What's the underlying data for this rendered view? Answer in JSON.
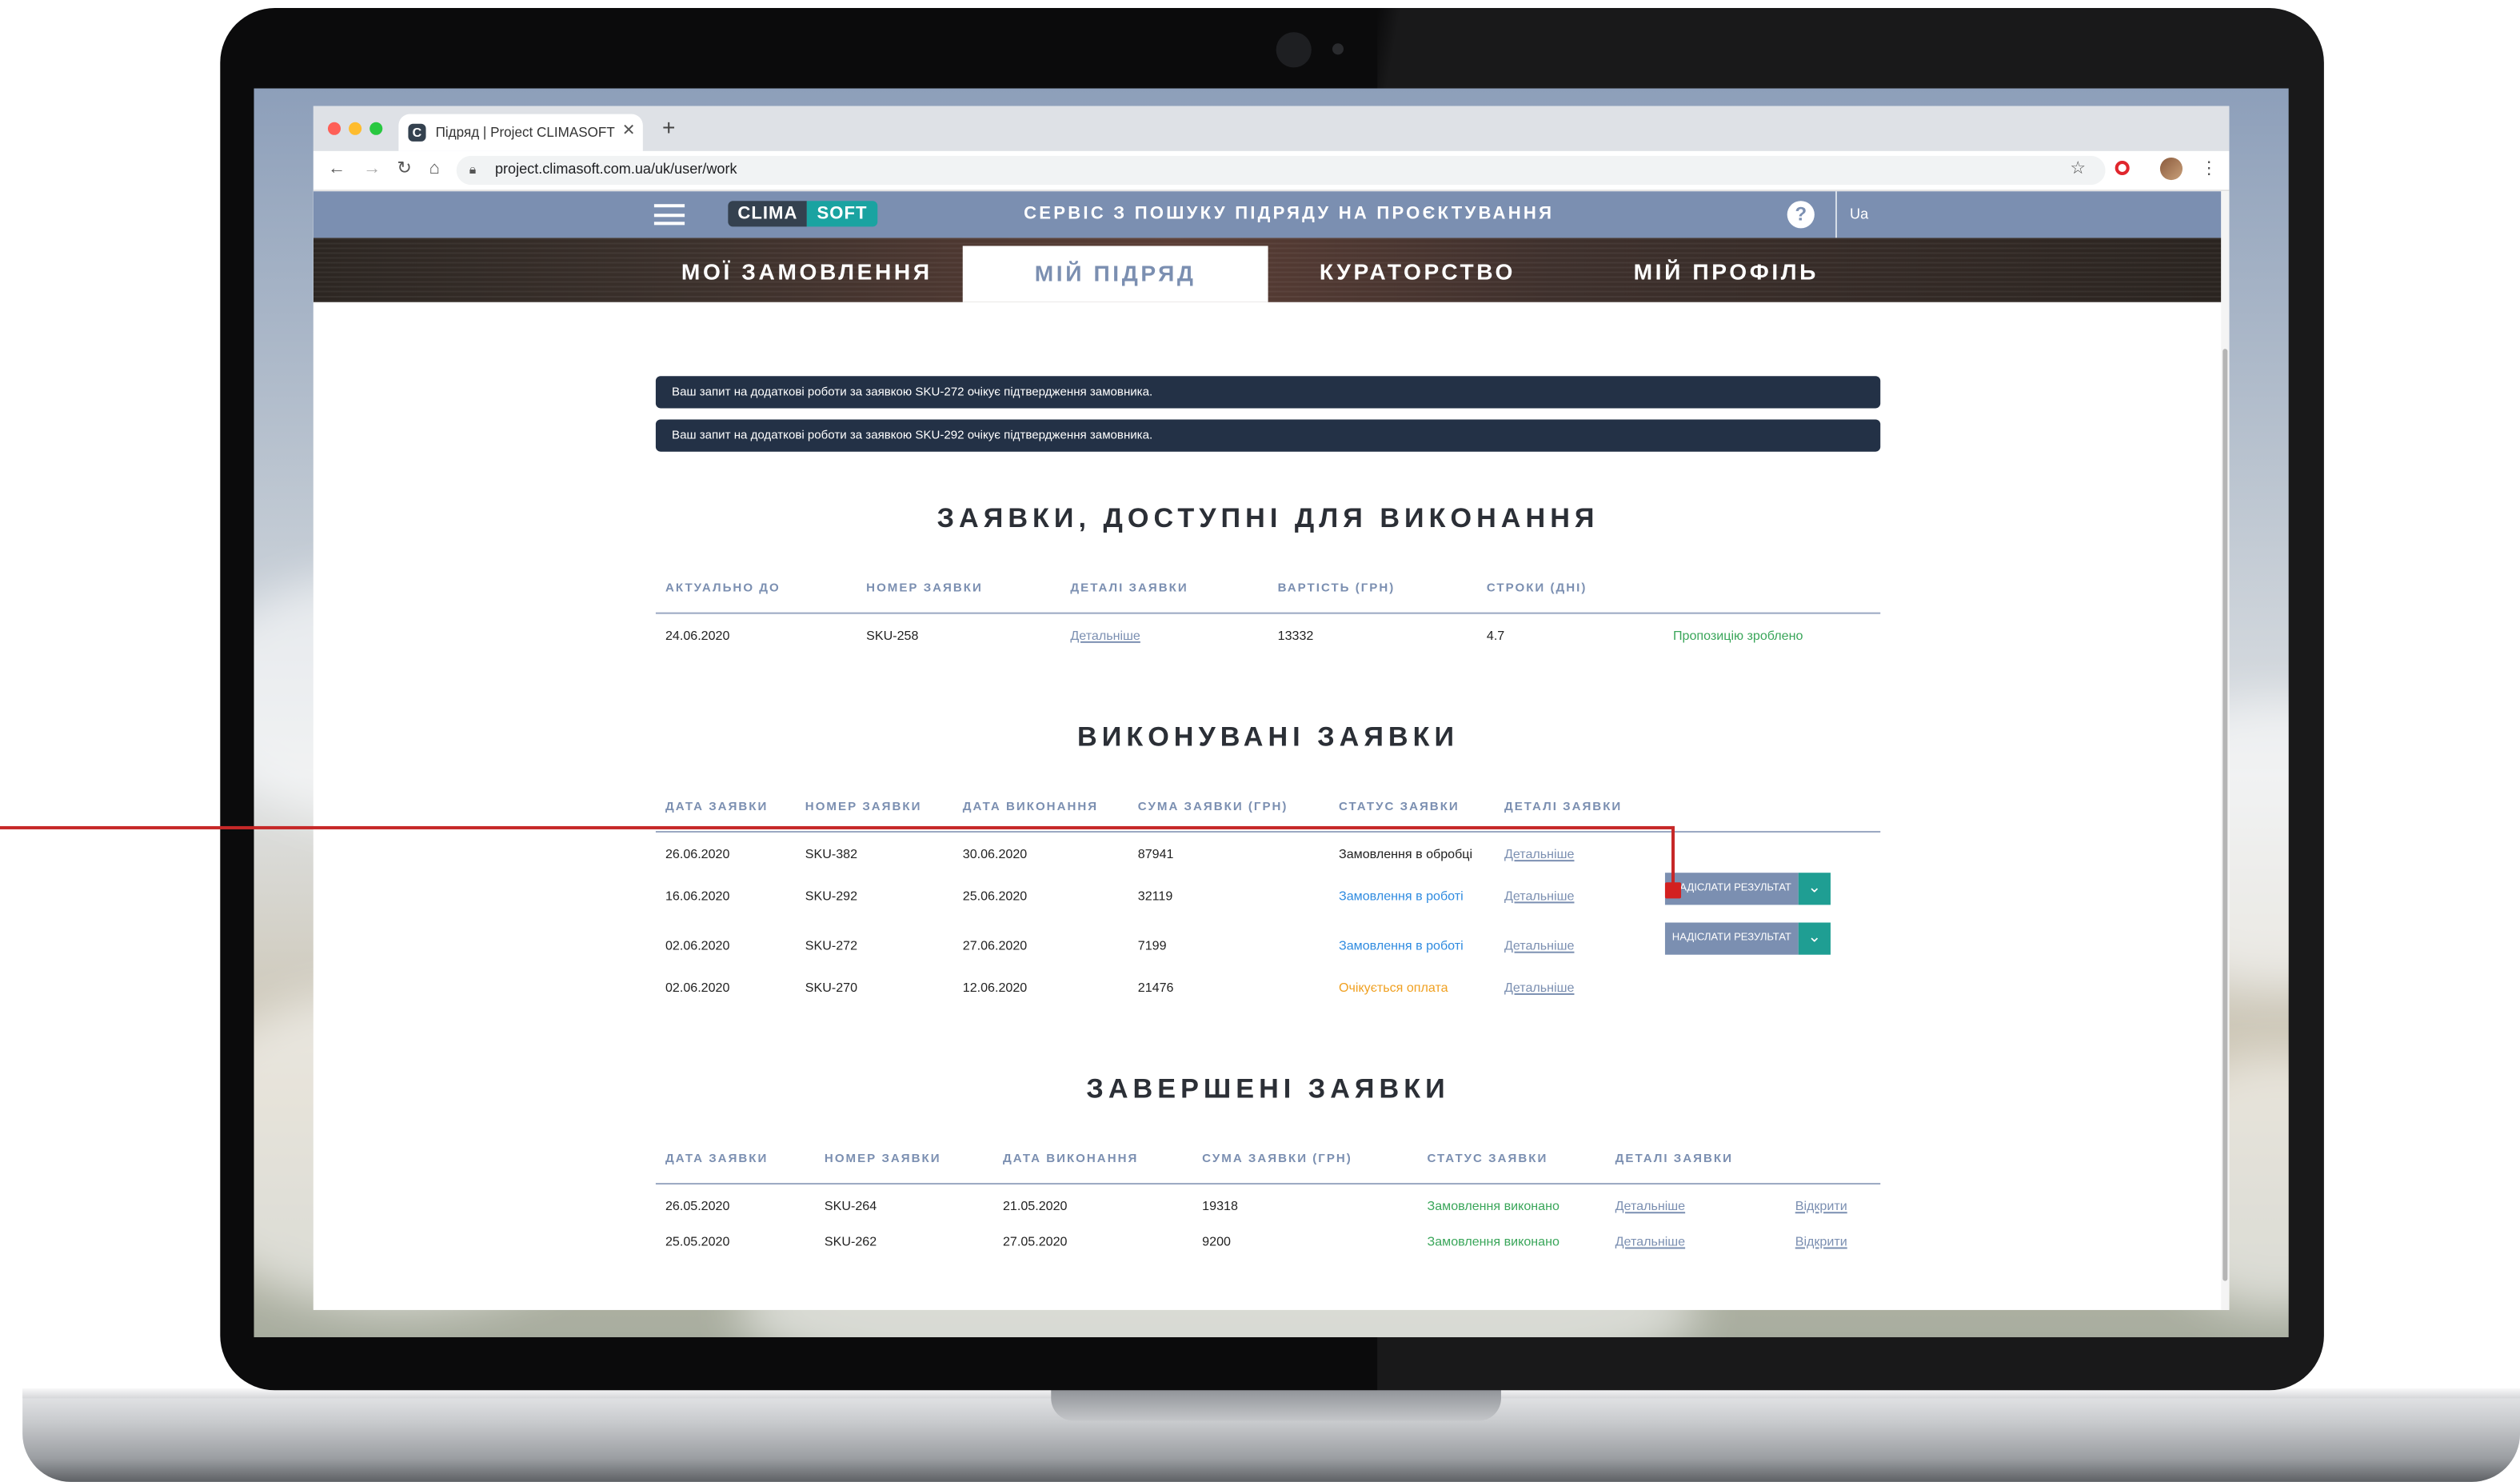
{
  "browser": {
    "tab_title": "Підряд | Project CLIMASOFT",
    "tab_favicon": "C",
    "url": "project.climasoft.com.ua/uk/user/work"
  },
  "header": {
    "logo_left": "CLIMA",
    "logo_right": "SOFT",
    "service_title": "СЕРВІС З ПОШУКУ ПІДРЯДУ НА ПРОЄКТУВАННЯ",
    "help": "?",
    "language": "Ua"
  },
  "nav": {
    "tabs": [
      {
        "label": "МОЇ ЗАМОВЛЕННЯ",
        "active": false
      },
      {
        "label": "МІЙ ПІДРЯД",
        "active": true
      },
      {
        "label": "КУРАТОРСТВО",
        "active": false
      },
      {
        "label": "МІЙ ПРОФІЛЬ",
        "active": false
      }
    ]
  },
  "notices": [
    "Ваш запит на додаткові роботи за заявкою SKU-272 очікує підтвердження замовника.",
    "Ваш запит на додаткові роботи за заявкою SKU-292 очікує підтвердження замовника."
  ],
  "available": {
    "title": "ЗАЯВКИ, ДОСТУПНІ ДЛЯ ВИКОНАННЯ",
    "headers": [
      "АКТУАЛЬНО ДО",
      "НОМЕР ЗАЯВКИ",
      "ДЕТАЛІ ЗАЯВКИ",
      "ВАРТІСТЬ (ГРН)",
      "СТРОКИ (ДНІ)"
    ],
    "rows": [
      {
        "until": "24.06.2020",
        "number": "SKU-258",
        "details": "Детальніше",
        "price": "13332",
        "days": "4.7",
        "status": "Пропозицію зроблено"
      }
    ]
  },
  "in_progress": {
    "title": "ВИКОНУВАНІ ЗАЯВКИ",
    "headers": [
      "ДАТА ЗАЯВКИ",
      "НОМЕР ЗАЯВКИ",
      "ДАТА ВИКОНАННЯ",
      "СУМА ЗАЯВКИ (ГРН)",
      "СТАТУС ЗАЯВКИ",
      "ДЕТАЛІ ЗАЯВКИ"
    ],
    "send_label": "НАДІСЛАТИ РЕЗУЛЬТАТ",
    "rows": [
      {
        "date": "26.06.2020",
        "number": "SKU-382",
        "due": "30.06.2020",
        "sum": "87941",
        "status": "Замовлення в обробці",
        "details": "Детальніше"
      },
      {
        "date": "16.06.2020",
        "number": "SKU-292",
        "due": "25.06.2020",
        "sum": "32119",
        "status": "Замовлення в роботі",
        "details": "Детальніше"
      },
      {
        "date": "02.06.2020",
        "number": "SKU-272",
        "due": "27.06.2020",
        "sum": "7199",
        "status": "Замовлення в роботі",
        "details": "Детальніше"
      },
      {
        "date": "02.06.2020",
        "number": "SKU-270",
        "due": "12.06.2020",
        "sum": "21476",
        "status": "Очікується оплата",
        "details": "Детальніше"
      }
    ]
  },
  "completed": {
    "title": "ЗАВЕРШЕНІ ЗАЯВКИ",
    "headers": [
      "ДАТА ЗАЯВКИ",
      "НОМЕР ЗАЯВКИ",
      "ДАТА ВИКОНАННЯ",
      "СУМА ЗАЯВКИ (ГРН)",
      "СТАТУС ЗАЯВКИ",
      "ДЕТАЛІ ЗАЯВКИ"
    ],
    "rows": [
      {
        "date": "26.05.2020",
        "number": "SKU-264",
        "due": "21.05.2020",
        "sum": "19318",
        "status": "Замовлення виконано",
        "details": "Детальніше",
        "open": "Відкрити"
      },
      {
        "date": "25.05.2020",
        "number": "SKU-262",
        "due": "27.05.2020",
        "sum": "9200",
        "status": "Замовлення виконано",
        "details": "Детальніше",
        "open": "Відкрити"
      }
    ]
  },
  "colors": {
    "accent": "#7b8fb1",
    "notice_bg": "#233146",
    "teal": "#1f9e93",
    "status_green": "#3aa65a",
    "status_blue": "#2f8be0",
    "status_orange": "#f0a020",
    "annotation_red": "#c62828"
  }
}
